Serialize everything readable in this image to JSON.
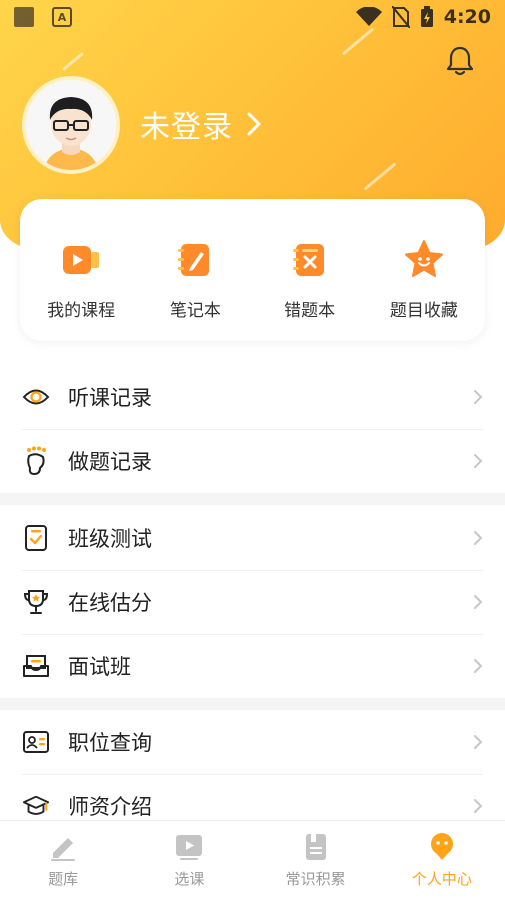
{
  "status_bar": {
    "time": "4:20",
    "notif_icon": "a-icon"
  },
  "profile": {
    "login_text": "未登录",
    "chevron": "›"
  },
  "quick_actions": [
    {
      "label": "我的课程",
      "icon": "video-course-icon"
    },
    {
      "label": "笔记本",
      "icon": "notebook-pen-icon"
    },
    {
      "label": "错题本",
      "icon": "wrong-answer-book-icon"
    },
    {
      "label": "题目收藏",
      "icon": "star-favorite-icon"
    }
  ],
  "menu_group_1": [
    {
      "label": "听课记录",
      "icon": "eye-icon"
    },
    {
      "label": "做题记录",
      "icon": "footprint-icon"
    }
  ],
  "menu_group_2": [
    {
      "label": "班级测试",
      "icon": "checklist-icon"
    },
    {
      "label": "在线估分",
      "icon": "trophy-icon"
    },
    {
      "label": "面试班",
      "icon": "inbox-icon"
    }
  ],
  "menu_group_3": [
    {
      "label": "职位查询",
      "icon": "id-card-icon"
    },
    {
      "label": "师资介绍",
      "icon": "graduation-cap-icon"
    }
  ],
  "menu_chevron": "›",
  "tabs": [
    {
      "label": "题库",
      "icon": "pencil-icon",
      "active": false
    },
    {
      "label": "选课",
      "icon": "play-icon",
      "active": false
    },
    {
      "label": "常识积累",
      "icon": "book-icon",
      "active": false
    },
    {
      "label": "个人中心",
      "icon": "person-icon",
      "active": true
    }
  ],
  "colors": {
    "accent": "#ffa31a",
    "header_start": "#ffd54a",
    "header_end": "#ffab2e",
    "inactive": "#9a9a9a"
  }
}
